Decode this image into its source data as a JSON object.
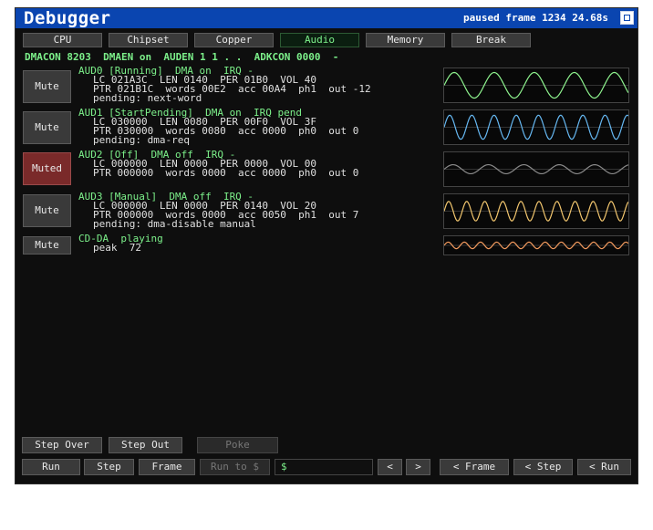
{
  "window": {
    "title": "Debugger",
    "status": "paused frame 1234 24.68s"
  },
  "tabs": [
    "CPU",
    "Chipset",
    "Copper",
    "Audio",
    "Memory",
    "Break"
  ],
  "active_tab": "Audio",
  "dmacon_line": "DMACON 8203  DMAEN on  AUDEN 1 1 . .  ADKCON 0000  -",
  "channels": [
    {
      "button": "Mute",
      "muted": false,
      "header": "AUD0 [Running]  DMA on  IRQ -",
      "line1": "LC 021A3C  LEN 0140  PER 01B0  VOL 40",
      "line2": "PTR 021B1C  words 00E2  acc 00A4  ph1  out -12",
      "line3": "pending: next-word",
      "wave_color": "#8ef28e",
      "wave_cycles": 4.6,
      "wave_amp": 0.85
    },
    {
      "button": "Mute",
      "muted": false,
      "header": "AUD1 [StartPending]  DMA on  IRQ pend",
      "line1": "LC 030000  LEN 0080  PER 00F0  VOL 3F",
      "line2": "PTR 030000  words 0080  acc 0000  ph0  out 0",
      "line3": "pending: dma-req",
      "wave_color": "#66b8f2",
      "wave_cycles": 8.3,
      "wave_amp": 0.8
    },
    {
      "button": "Muted",
      "muted": true,
      "header": "AUD2 [Off]  DMA off  IRQ -",
      "line1": "LC 000000  LEN 0000  PER 0000  VOL 00",
      "line2": "PTR 000000  words 0000  acc 0000  ph0  out 0",
      "line3": "",
      "wave_color": "#8a8a8a",
      "wave_cycles": 5.2,
      "wave_amp": 0.3
    },
    {
      "button": "Mute",
      "muted": false,
      "header": "AUD3 [Manual]  DMA off  IRQ -",
      "line1": "LC 000000  LEN 0000  PER 0140  VOL 20",
      "line2": "PTR 000000  words 0000  acc 0050  ph1  out 7",
      "line3": "pending: dma-disable manual",
      "wave_color": "#f2c66e",
      "wave_cycles": 10.2,
      "wave_amp": 0.65
    }
  ],
  "cdda": {
    "button": "Mute",
    "header": "CD-DA  playing",
    "line1": "peak  72",
    "wave_color": "#f29a5e",
    "wave_cycles": 11.4,
    "wave_amp": 0.45
  },
  "controls": {
    "step_over": "Step Over",
    "step_out": "Step Out",
    "poke": "Poke",
    "run": "Run",
    "step": "Step",
    "frame": "Frame",
    "run_to": "Run to $",
    "address_value": "$",
    "prev_arrow": "<",
    "next_arrow": ">",
    "back_frame": "< Frame",
    "back_step": "< Step",
    "back_run": "< Run"
  }
}
